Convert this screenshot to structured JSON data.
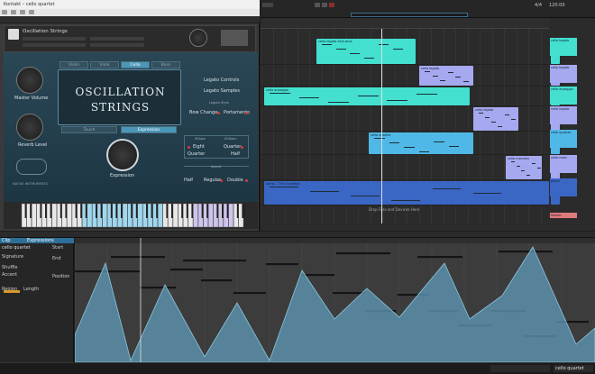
{
  "plugin": {
    "window_title": "Kontakt – cello quartet",
    "instrument_name": "Oscillation Strings",
    "logo_line1": "OSCILLATION",
    "logo_line2": "STRINGS",
    "tabs": [
      "Violin",
      "Viola",
      "Cello",
      "Bass"
    ],
    "active_tab": "Cello",
    "mode_tabs": [
      "Touch",
      "Expression"
    ],
    "active_mode_tab": "Expression",
    "master_volume_label": "Master Volume",
    "reverb_level_label": "Reverb Level",
    "expression_label": "Expression",
    "legato_controls": "Legato Controls",
    "legato_samples": "Legato Samples",
    "legato_style": "Legato Style",
    "bow_change": "Bow Change",
    "portamento": "Portamento",
    "bpm_left": "90bpm",
    "bpm_right": "120bpm",
    "eighth": "Eight",
    "quarter": "Quarter",
    "quarter2": "Quarter",
    "half": "Half",
    "speed_label": "Speed",
    "speed_half": "Half",
    "speed_regular": "Regular",
    "speed_double": "Double",
    "brand": "NATIVE INSTRUMENTS"
  },
  "arrangement": {
    "clips": [
      {
        "label": "cello legato exclusive",
        "color": "#43e0d0"
      },
      {
        "label": "cello legato",
        "color": "#4fb8e6"
      },
      {
        "label": "cello legato",
        "color": "#a6a8f0"
      },
      {
        "label": "cello arpeggio",
        "color": "#43e0d0"
      },
      {
        "label": "cello legato",
        "color": "#a6a8f0"
      },
      {
        "label": "cello quartet",
        "color": "#4fb8e6"
      },
      {
        "label": "cello marcato",
        "color": "#a6a8f0"
      },
      {
        "label": "piano – The Grandest",
        "color": "#3a66c4"
      }
    ],
    "track_labels": [
      "cello legato",
      "cello legato",
      "cello arpeggio",
      "cello legato",
      "cello quartet",
      "cello marc",
      "piano",
      "Master"
    ],
    "drop_hint": "Drop Files and Devices Here",
    "bpm": "120.00",
    "sig": "4/4"
  },
  "editor": {
    "tabs": [
      "Clip",
      "Expressions"
    ],
    "clip_name": "cello quartet",
    "inspector_labels": [
      "Signature",
      "Shuffle",
      "Accent",
      "Region",
      "Length",
      "Start",
      "End",
      "Position"
    ],
    "status_clip": "cello quartet"
  }
}
